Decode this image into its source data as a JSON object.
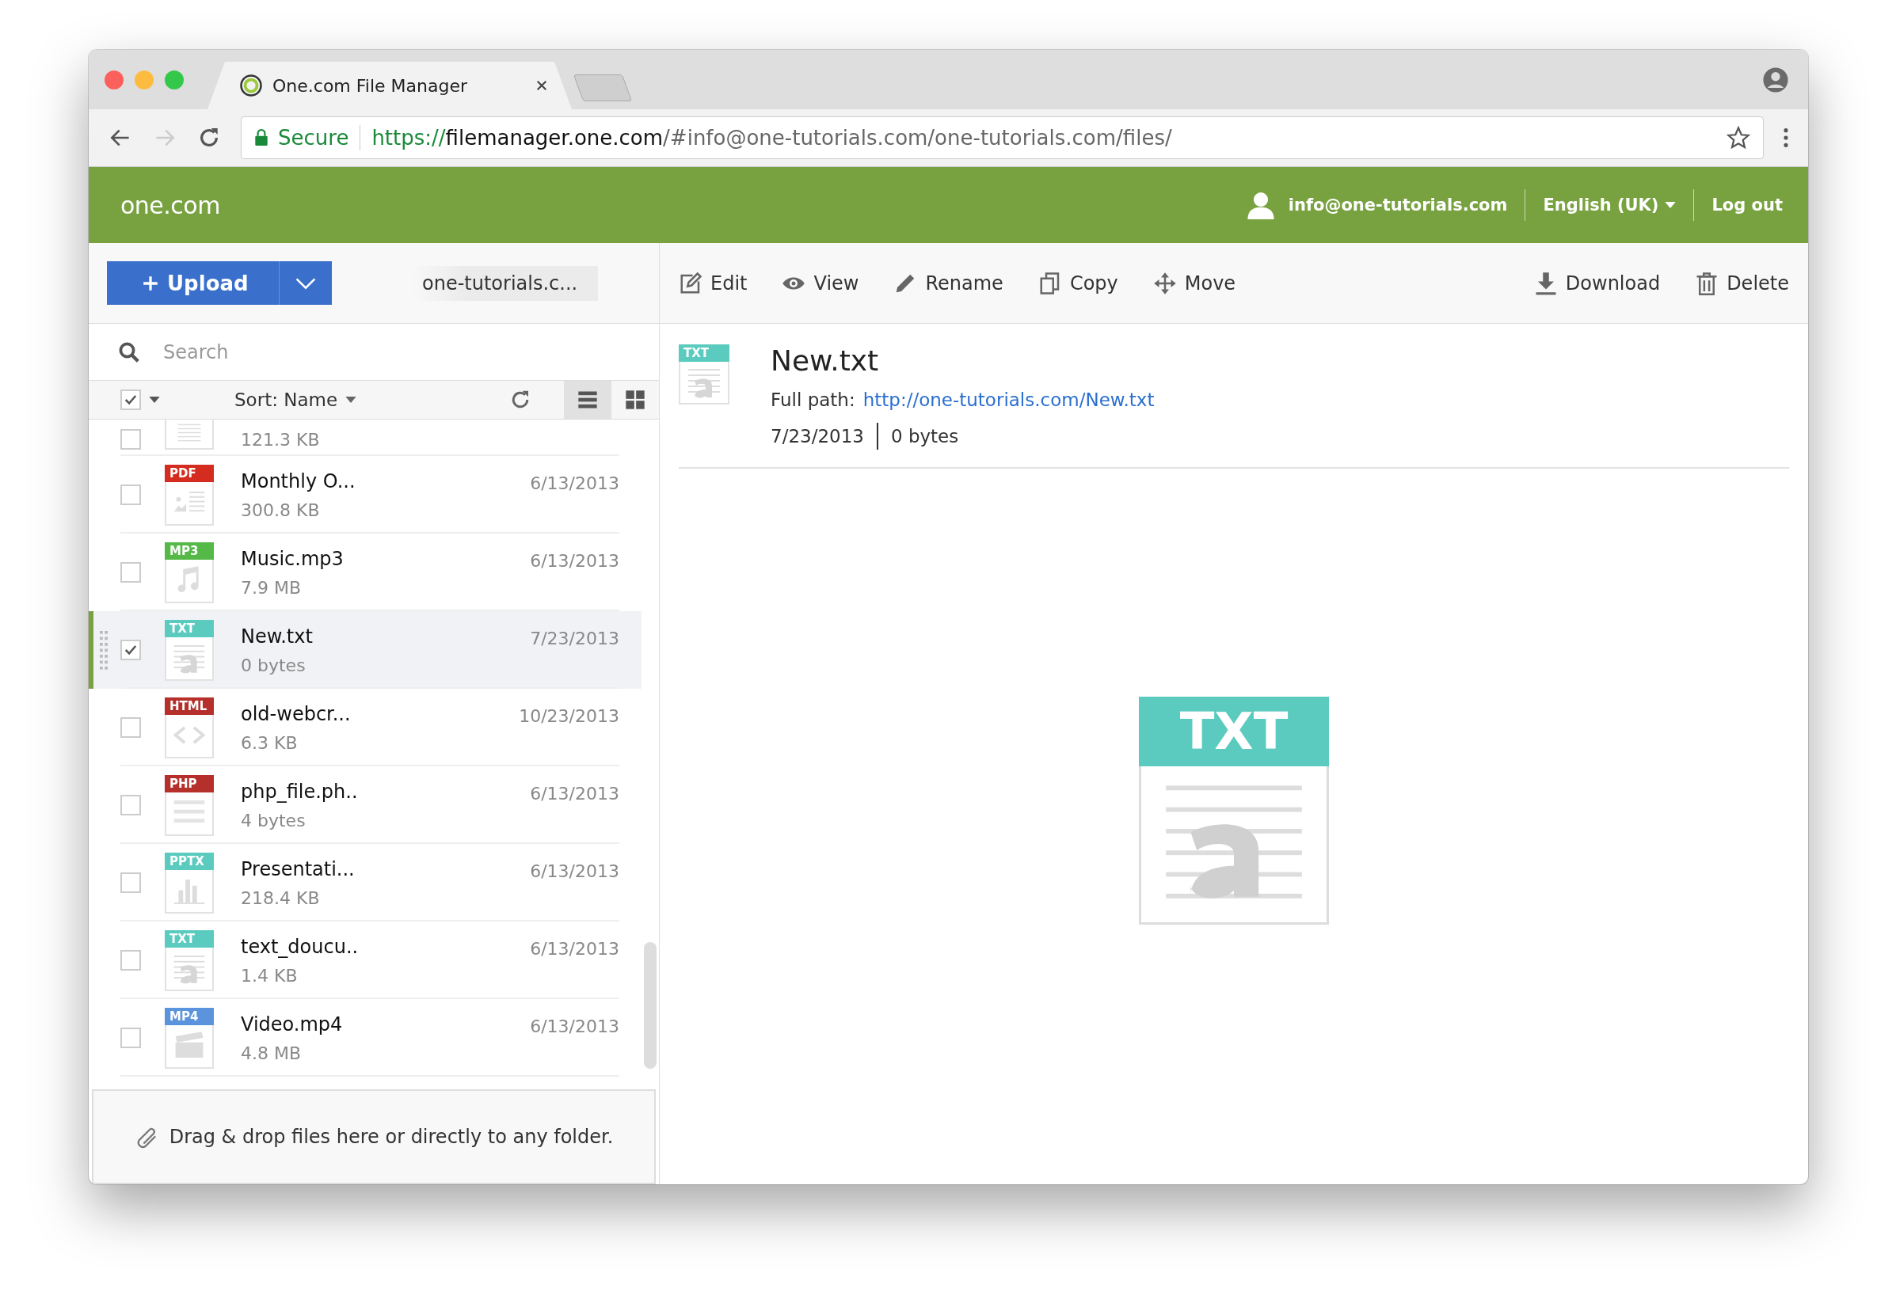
{
  "browser": {
    "tab_title": "One.com File Manager",
    "secure_label": "Secure",
    "url": {
      "scheme": "https://",
      "host": "filemanager.one.com",
      "path": "/#info@one-tutorials.com/one-tutorials.com/files/"
    }
  },
  "header": {
    "logo": "one.com",
    "user": "info@one-tutorials.com",
    "language": "English (UK)",
    "logout": "Log out"
  },
  "sidebar": {
    "upload": "Upload",
    "breadcrumb": "one-tutorials.c...",
    "search": {
      "placeholder": "Search"
    },
    "select_all": {
      "checked": true
    },
    "sort": "Sort: Name",
    "views": [
      {
        "kind": "list",
        "selected": true
      },
      {
        "kind": "grid",
        "selected": false
      }
    ],
    "files": [
      {
        "kind": "doc",
        "size": "121.3 KB",
        "partial": true,
        "checked": false,
        "selected": false
      },
      {
        "kind": "pdf",
        "badge": "PDF",
        "color": "#d42c1e",
        "name": "Monthly O...",
        "date": "6/13/2013",
        "size": "300.8 KB",
        "checked": false,
        "selected": false
      },
      {
        "kind": "mp3",
        "badge": "MP3",
        "color": "#55b947",
        "name": "Music.mp3",
        "date": "6/13/2013",
        "size": "7.9 MB",
        "checked": false,
        "selected": false
      },
      {
        "kind": "txt",
        "badge": "TXT",
        "color": "#5ccbbf",
        "name": "New.txt",
        "date": "7/23/2013",
        "size": "0 bytes",
        "checked": true,
        "selected": true
      },
      {
        "kind": "html",
        "badge": "HTML",
        "color": "#b5302b",
        "name": "old-webcr...",
        "date": "10/23/2013",
        "size": "6.3 KB",
        "checked": false,
        "selected": false
      },
      {
        "kind": "php",
        "badge": "PHP",
        "color": "#b5302b",
        "name": "php_file.ph..",
        "date": "6/13/2013",
        "size": "4 bytes",
        "checked": false,
        "selected": false
      },
      {
        "kind": "pptx",
        "badge": "PPTX",
        "color": "#5ccbbf",
        "name": "Presentati...",
        "date": "6/13/2013",
        "size": "218.4 KB",
        "checked": false,
        "selected": false
      },
      {
        "kind": "txt",
        "badge": "TXT",
        "color": "#5ccbbf",
        "name": "text_doucu..",
        "date": "6/13/2013",
        "size": "1.4 KB",
        "checked": false,
        "selected": false
      },
      {
        "kind": "mp4",
        "badge": "MP4",
        "color": "#5b93dc",
        "name": "Video.mp4",
        "date": "6/13/2013",
        "size": "4.8 MB",
        "checked": false,
        "selected": false
      }
    ],
    "drop_hint": "Drag & drop files here or directly to any folder."
  },
  "toolbar": {
    "left_actions": [
      {
        "kind": "edit",
        "label": "Edit"
      },
      {
        "kind": "view",
        "label": "View"
      },
      {
        "kind": "rename",
        "label": "Rename"
      },
      {
        "kind": "copy",
        "label": "Copy"
      },
      {
        "kind": "move",
        "label": "Move"
      }
    ],
    "right_actions": [
      {
        "kind": "download",
        "label": "Download"
      },
      {
        "kind": "delete",
        "label": "Delete"
      }
    ]
  },
  "detail": {
    "badge": "TXT",
    "color": "#5ccbbf",
    "name": "New.txt",
    "path_label": "Full path:",
    "path_link": "http://one-tutorials.com/New.txt",
    "date": "7/23/2013",
    "size": "0 bytes",
    "preview_badge": "TXT"
  }
}
